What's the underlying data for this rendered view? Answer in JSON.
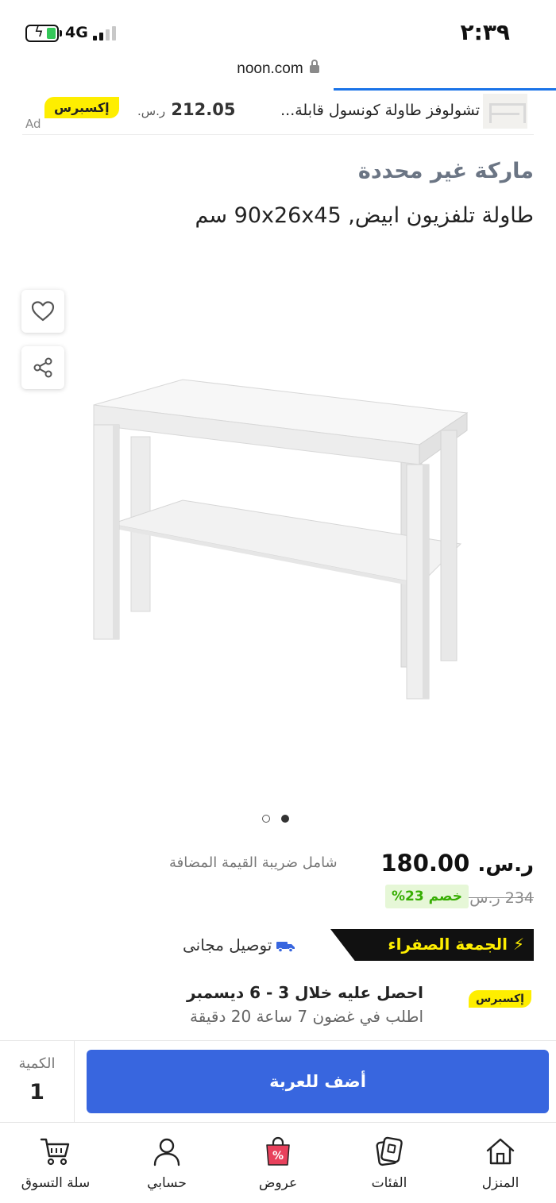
{
  "status_bar": {
    "network": "4G",
    "time": "٢:٣٩",
    "battery_color": "#34c759"
  },
  "browser": {
    "url": "noon.com",
    "lock_icon": "lock-icon"
  },
  "ad": {
    "title": "تشولوفز طاولة كونسول قابلة...",
    "price": "212.05",
    "currency": "ر.س.",
    "badge": "إكسبرس",
    "label": "Ad"
  },
  "product": {
    "brand": "ماركة غير محددة",
    "title": "طاولة تلفزيون ابيض, 90x26x45 سم",
    "image_alt": "white-tv-table",
    "gallery": {
      "count": 2,
      "active_index": 1
    }
  },
  "pricing": {
    "currency": "ر.س.",
    "price": "180.00",
    "vat_note": "شامل ضريبة القيمة المضافة",
    "old_price": "234 ر.س.",
    "discount": "خصم 23%",
    "discount_color": "#38ae04"
  },
  "promo": {
    "yellow_friday": "الجمعة الصفراء",
    "bolt_icon": "⚡",
    "free_delivery": "توصيل مجانی",
    "truck_icon_color": "#3866df"
  },
  "delivery": {
    "badge": "إكسبرس",
    "line1": "احصل عليه خلال 3 - 6 ديسمبر",
    "line2": "اطلب في غضون 7 ساعة 20 دقيقة"
  },
  "cart": {
    "qty_label": "الكمية",
    "qty_value": "1",
    "add_to_cart": "أضف للعربة",
    "button_color": "#3866df"
  },
  "nav": {
    "items": [
      {
        "label": "المنزل",
        "icon": "home-icon"
      },
      {
        "label": "الفئات",
        "icon": "categories-icon"
      },
      {
        "label": "عروض",
        "icon": "deals-icon"
      },
      {
        "label": "حسابي",
        "icon": "account-icon"
      },
      {
        "label": "سلة التسوق",
        "icon": "cart-icon"
      }
    ]
  }
}
